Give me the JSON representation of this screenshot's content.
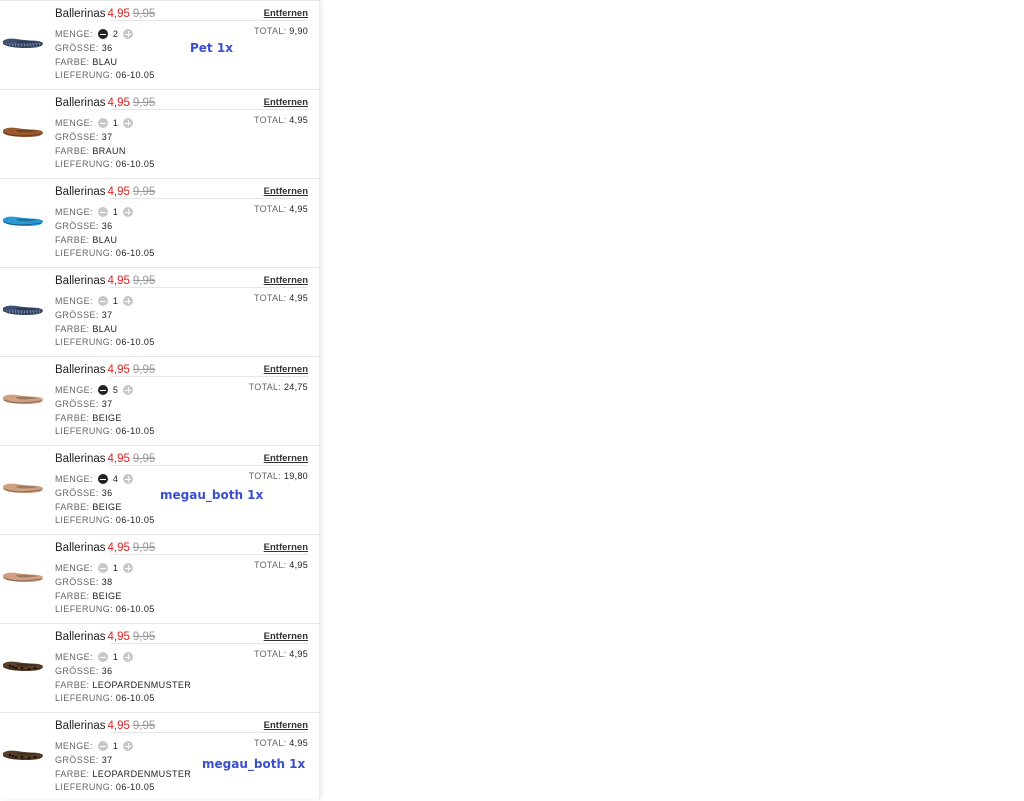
{
  "labels": {
    "menge": "MENGE:",
    "groesse": "GRÖSSE:",
    "farbe": "FARBE:",
    "lieferung": "LIEFERUNG:",
    "total": "TOTAL:",
    "remove": "Entfernen"
  },
  "items": [
    {
      "name": "Ballerinas",
      "price": "4,95",
      "old_price": "9,95",
      "qty": "2",
      "minus_active": true,
      "size": "36",
      "color": "BLAU",
      "delivery": "06-10.05",
      "total": "9,90",
      "shoe_color": "#3d4f73",
      "shoe_icon": "blue-striped-ballerina-icon"
    },
    {
      "name": "Ballerinas",
      "price": "4,95",
      "old_price": "9,95",
      "qty": "1",
      "minus_active": false,
      "size": "37",
      "color": "BRAUN",
      "delivery": "06-10.05",
      "total": "4,95",
      "shoe_color": "#9a5a2e",
      "shoe_icon": "brown-ballerina-icon"
    },
    {
      "name": "Ballerinas",
      "price": "4,95",
      "old_price": "9,95",
      "qty": "1",
      "minus_active": false,
      "size": "36",
      "color": "BLAU",
      "delivery": "06-10.05",
      "total": "4,95",
      "shoe_color": "#2a9ad6",
      "shoe_icon": "bright-blue-ballerina-icon"
    },
    {
      "name": "Ballerinas",
      "price": "4,95",
      "old_price": "9,95",
      "qty": "1",
      "minus_active": false,
      "size": "37",
      "color": "BLAU",
      "delivery": "06-10.05",
      "total": "4,95",
      "shoe_color": "#3d4f73",
      "shoe_icon": "blue-striped-ballerina-icon"
    },
    {
      "name": "Ballerinas",
      "price": "4,95",
      "old_price": "9,95",
      "qty": "5",
      "minus_active": true,
      "size": "37",
      "color": "BEIGE",
      "delivery": "06-10.05",
      "total": "24,75",
      "shoe_color": "#d1a080",
      "shoe_icon": "beige-ballerina-icon"
    },
    {
      "name": "Ballerinas",
      "price": "4,95",
      "old_price": "9,95",
      "qty": "4",
      "minus_active": true,
      "size": "36",
      "color": "BEIGE",
      "delivery": "06-10.05",
      "total": "19,80",
      "shoe_color": "#d1a080",
      "shoe_icon": "beige-ballerina-icon"
    },
    {
      "name": "Ballerinas",
      "price": "4,95",
      "old_price": "9,95",
      "qty": "1",
      "minus_active": false,
      "size": "38",
      "color": "BEIGE",
      "delivery": "06-10.05",
      "total": "4,95",
      "shoe_color": "#d1a080",
      "shoe_icon": "beige-ballerina-icon"
    },
    {
      "name": "Ballerinas",
      "price": "4,95",
      "old_price": "9,95",
      "qty": "1",
      "minus_active": false,
      "size": "36",
      "color": "LEOPARDENMUSTER",
      "delivery": "06-10.05",
      "total": "4,95",
      "shoe_color": "#5a3f28",
      "shoe_icon": "leopard-ballerina-icon"
    },
    {
      "name": "Ballerinas",
      "price": "4,95",
      "old_price": "9,95",
      "qty": "1",
      "minus_active": false,
      "size": "37",
      "color": "LEOPARDENMUSTER",
      "delivery": "06-10.05",
      "total": "4,95",
      "shoe_color": "#5a3f28",
      "shoe_icon": "leopard-ballerina-icon"
    }
  ],
  "annotations": [
    {
      "text": "Pet 1x",
      "item": 0
    },
    {
      "text": "megau_both 1x",
      "item": 5
    },
    {
      "text": "megau_both 1x",
      "item": 8
    }
  ],
  "colors": {
    "price": "#e02020",
    "annotation": "#3a4fd0"
  }
}
